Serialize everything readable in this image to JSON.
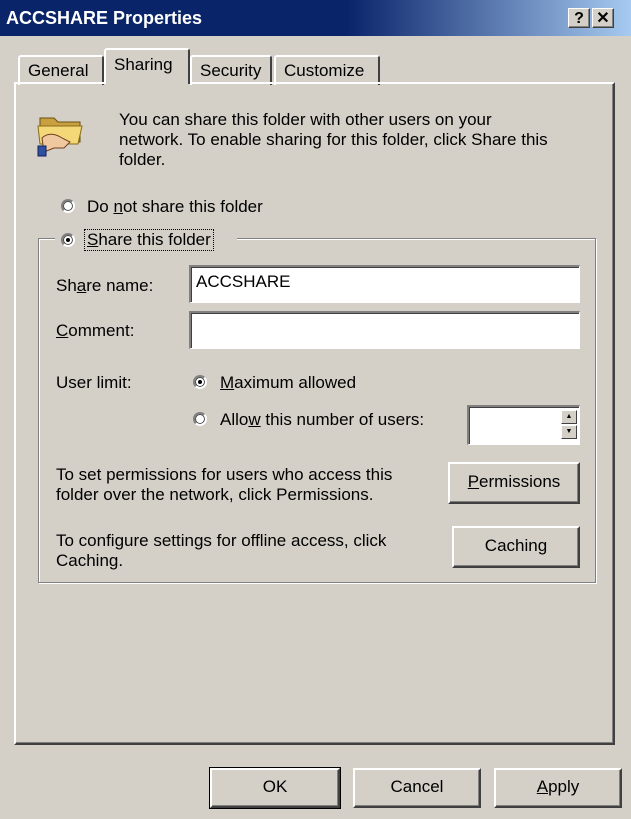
{
  "window": {
    "title": "ACCSHARE Properties",
    "help_label": "?",
    "close_label": "✕"
  },
  "tabs": [
    {
      "label": "General"
    },
    {
      "label": "Sharing"
    },
    {
      "label": "Security"
    },
    {
      "label": "Customize"
    }
  ],
  "sharing": {
    "intro_lines": [
      "You can share this folder with other users on your",
      "network.  To enable sharing for this folder, click Share this",
      "folder."
    ],
    "do_not_share": {
      "pre": "Do ",
      "key": "n",
      "post": "ot share this folder",
      "checked": false
    },
    "share": {
      "pre": "",
      "key": "S",
      "post": "hare this folder",
      "checked": true
    },
    "share_name": {
      "pre": "Sh",
      "key": "a",
      "post": "re name:",
      "value": "ACCSHARE"
    },
    "comment": {
      "pre": "",
      "key": "C",
      "post": "omment:",
      "value": ""
    },
    "user_limit_label": "User limit:",
    "max_allowed": {
      "pre": "",
      "key": "M",
      "post": "aximum allowed",
      "checked": true
    },
    "allow_number": {
      "pre": "Allo",
      "key": "w",
      "post": " this number of users:",
      "checked": false,
      "value": ""
    },
    "permissions_text": [
      "To set permissions for users who access this",
      "folder over the network, click Permissions."
    ],
    "permissions_button": {
      "pre": "",
      "key": "P",
      "post": "ermissions"
    },
    "caching_text": [
      "To configure settings for offline access, click",
      "Caching."
    ],
    "caching_button": {
      "pre": "Cachin",
      "key": "g",
      "post": ""
    }
  },
  "footer": {
    "ok_label": "OK",
    "cancel_label": "Cancel",
    "apply": {
      "pre": "",
      "key": "A",
      "post": "pply"
    }
  },
  "icons": {
    "folder": "shared-folder-icon"
  }
}
